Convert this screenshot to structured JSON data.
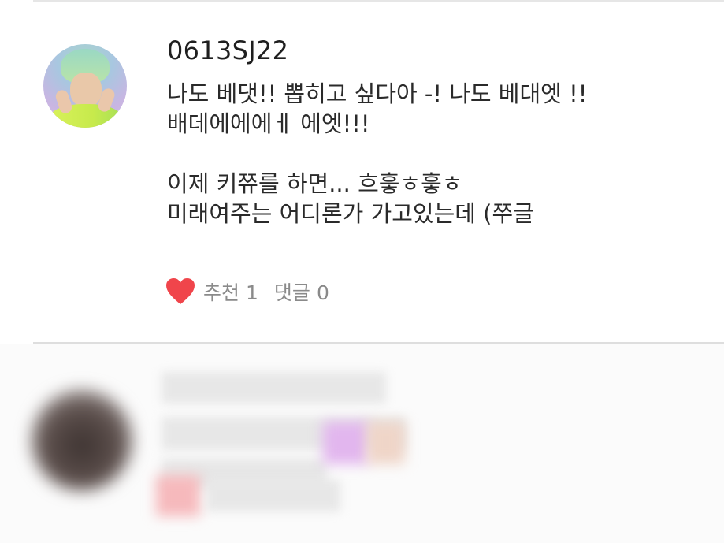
{
  "comment": {
    "username": "0613SJ22",
    "body_lines": [
      "나도 베댓!! 뽑히고 싶다아 -! 나도 베대엣 !!",
      "배데에에에ㅔ 에엣!!!",
      "",
      "이제 키쮸를 하면... 흐흫ㅎ흫ㅎ",
      "미래여주는 어디론가 가고있는데 (쭈글"
    ],
    "likes_label": "추천",
    "likes_count": "1",
    "replies_label": "댓글",
    "replies_count": "0",
    "heart_icon": "heart-icon",
    "heart_color": "#f0454b"
  },
  "next_comment": {
    "blurred": true
  }
}
